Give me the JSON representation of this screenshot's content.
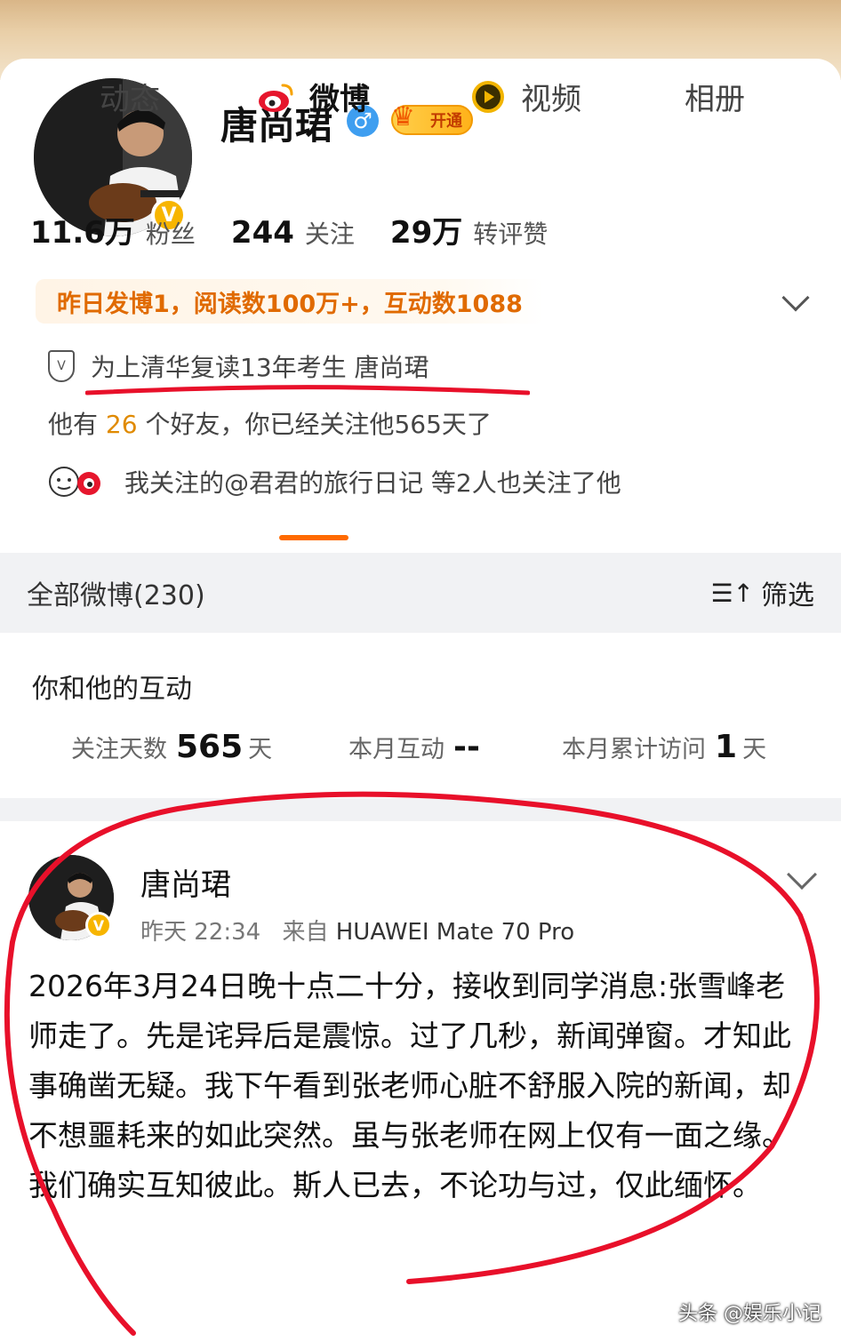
{
  "profile": {
    "name": "唐尚珺",
    "gender_symbol": "♂",
    "verified_symbol": "V",
    "vip_label": "开通",
    "stats": [
      {
        "num": "11.6万",
        "label": "粉丝"
      },
      {
        "num": "244",
        "label": "关注"
      },
      {
        "num": "29万",
        "label": "转评赞"
      }
    ],
    "hot_text": "昨日发博1，阅读数100万+，互动数1088",
    "bio": "为上清华复读13年考生  唐尚珺",
    "friends_pre": "他有 ",
    "friends_count": "26",
    "friends_post": " 个好友，你已经关注他565天了",
    "mutual": "我关注的@君君的旅行日记 等2人也关注了他"
  },
  "tabs": [
    "动态",
    "微博",
    "视频",
    "相册"
  ],
  "filterbar": {
    "all_label": "全部微博(230)",
    "filter_icon": "☰↑",
    "filter_label": "筛选"
  },
  "interaction": {
    "title": "你和他的互动",
    "items": [
      {
        "label": "关注天数",
        "value": "565",
        "unit": "天"
      },
      {
        "label": "本月互动",
        "value": "--",
        "unit": ""
      },
      {
        "label": "本月累计访问",
        "value": "1",
        "unit": "天"
      }
    ]
  },
  "post": {
    "author": "唐尚珺",
    "time": "昨天 22:34",
    "from_label": "来自",
    "device": "HUAWEI Mate 70 Pro",
    "text": "2026年3月24日晚十点二十分，接收到同学消息:张雪峰老师走了。先是诧异后是震惊。过了几秒，新闻弹窗。才知此事确凿无疑。我下午看到张老师心脏不舒服入院的新闻，却不想噩耗来的如此突然。虽与张老师在网上仅有一面之缘。我们确实互知彼此。斯人已去，不论功与过，仅此缅怀。"
  },
  "watermark": "头条 @娱乐小记",
  "colors": {
    "accent": "#ff6a00",
    "hot_text": "#e06a00",
    "annotation_red": "#e8102a",
    "verified": "#f7b500",
    "gender": "#3e9ef0"
  }
}
